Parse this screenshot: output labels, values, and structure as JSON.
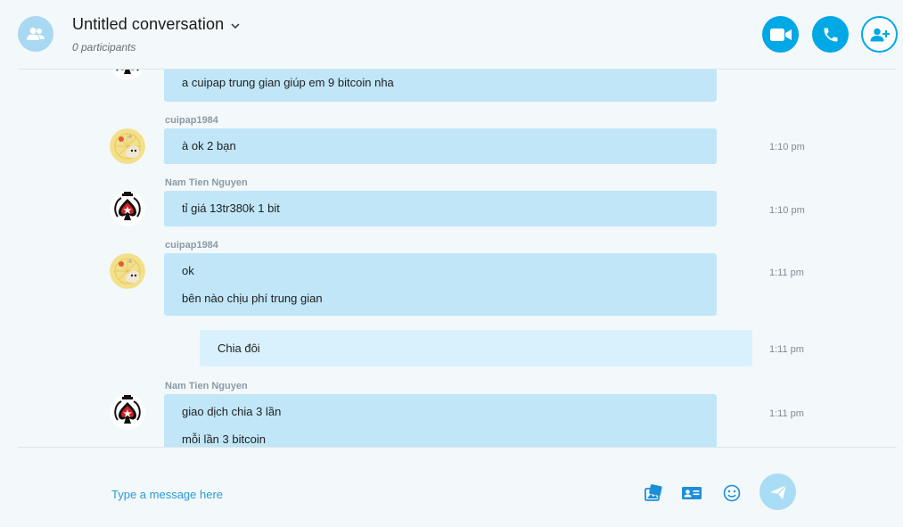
{
  "header": {
    "title": "Untitled conversation",
    "subtitle": "0 participants",
    "icons": {
      "group": "group-icon",
      "chevron": "chevron-down-icon",
      "video": "video-call-icon",
      "call": "phone-call-icon",
      "add": "add-participant-icon"
    }
  },
  "messages": [
    {
      "sender": "",
      "lines": [
        "a cuipap trung gian giúp em 9 bitcoin nha"
      ],
      "time": "",
      "avatar": "poker-avatar",
      "own": false
    },
    {
      "sender": "cuipap1984",
      "lines": [
        "à ok 2 bạn"
      ],
      "time": "1:10 pm",
      "avatar": "cat-avatar",
      "own": false
    },
    {
      "sender": "Nam Tien Nguyen",
      "lines": [
        "tỉ giá 13tr380k 1 bit"
      ],
      "time": "1:10 pm",
      "avatar": "poker-avatar",
      "own": false
    },
    {
      "sender": "cuipap1984",
      "lines": [
        "ok",
        "bên nào chịu phí trung gian"
      ],
      "time": "1:11 pm",
      "avatar": "cat-avatar",
      "own": false
    },
    {
      "sender": "",
      "lines": [
        "Chia đôi"
      ],
      "time": "1:11 pm",
      "avatar": "",
      "own": true
    },
    {
      "sender": "Nam Tien Nguyen",
      "lines": [
        "giao dịch chia 3 lần",
        "mỗi lần 3 bitcoin"
      ],
      "time": "1:11 pm",
      "avatar": "poker-avatar",
      "own": false
    }
  ],
  "composer": {
    "placeholder": "Type a message here",
    "icons": [
      "media-gallery-icon",
      "contact-card-icon",
      "emoji-icon",
      "send-icon"
    ]
  },
  "colors": {
    "accent": "#00a8e6",
    "bubble": "#c0e6f8",
    "own_bubble": "#d9f1fc",
    "background": "#f3f8fb"
  }
}
